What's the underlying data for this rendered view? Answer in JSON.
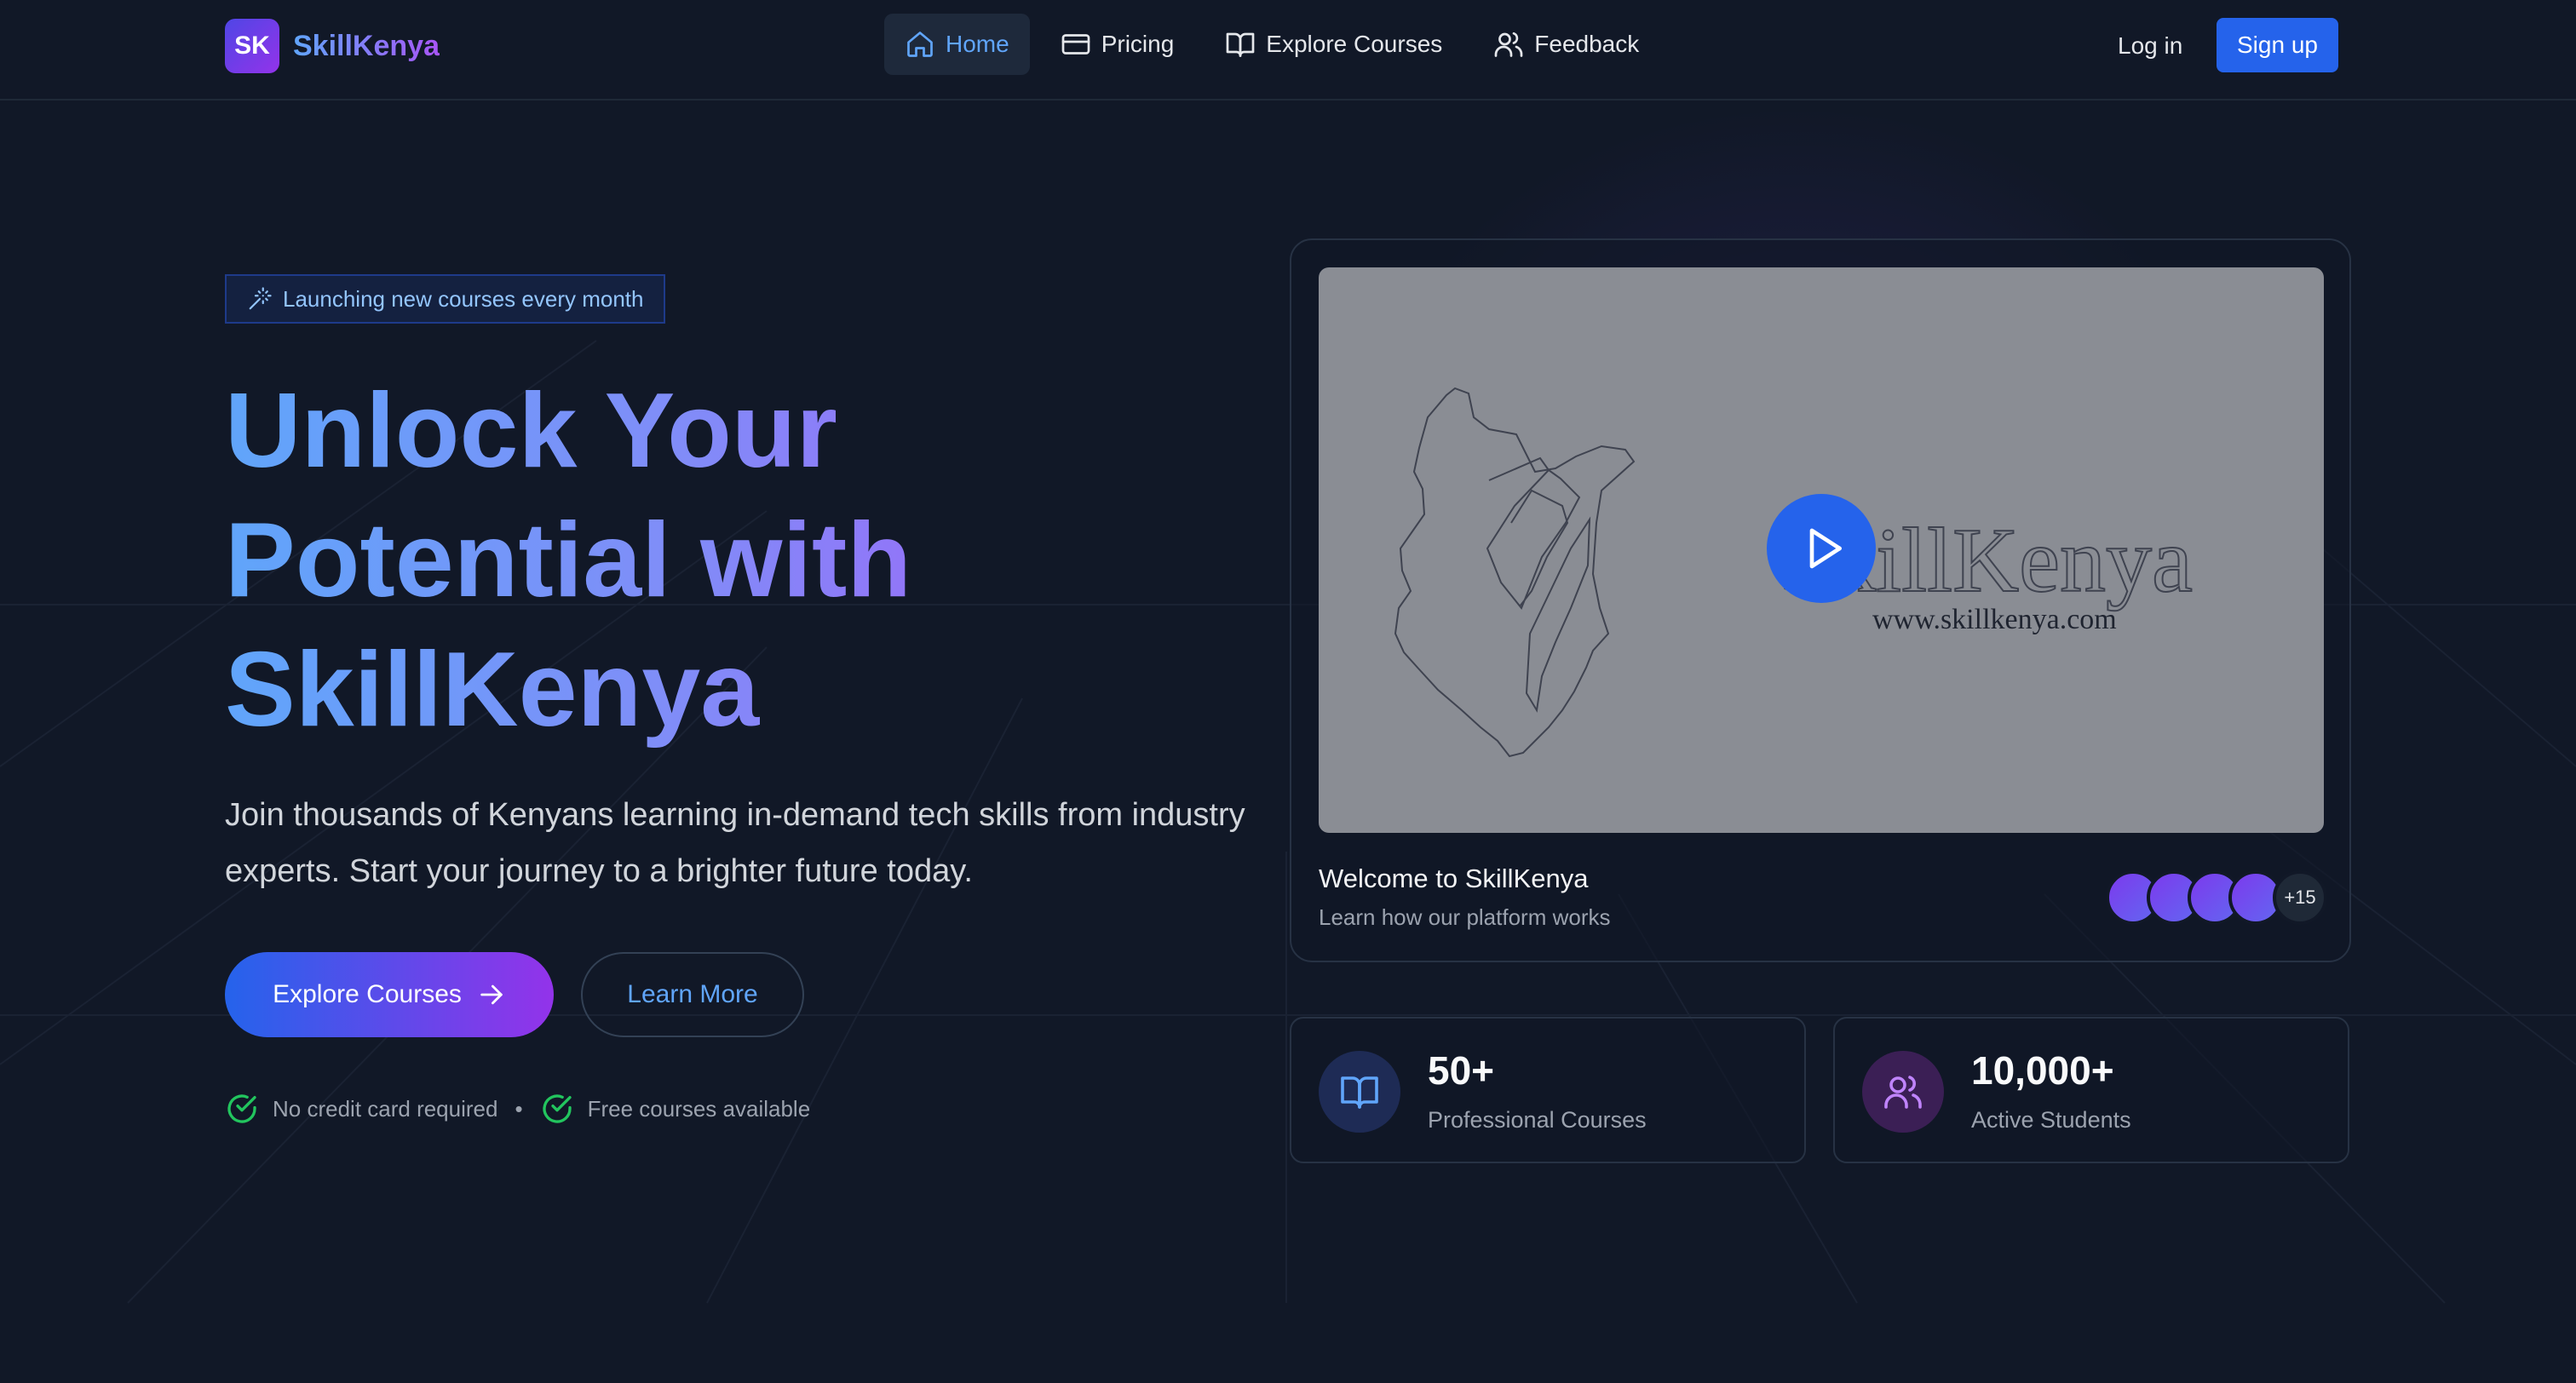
{
  "header": {
    "logo_mark": "SK",
    "logo_text": "SkillKenya",
    "nav": [
      {
        "label": "Home",
        "icon": "home-icon",
        "active": true
      },
      {
        "label": "Pricing",
        "icon": "credit-card-icon"
      },
      {
        "label": "Explore Courses",
        "icon": "book-open-icon"
      },
      {
        "label": "Feedback",
        "icon": "users-icon"
      }
    ],
    "login_label": "Log in",
    "signup_label": "Sign up"
  },
  "hero": {
    "badge": "Launching new courses every month",
    "badge_icon": "magic-wand-icon",
    "headline": [
      "Unlock Your",
      "Potential with",
      "SkillKenya"
    ],
    "subtext": "Join thousands of Kenyans learning in-demand tech skills from industry experts. Start your journey to a brighter future today.",
    "primary_button": "Explore Courses",
    "secondary_button": "Learn More",
    "perks": [
      "No credit card required",
      "Free courses available"
    ],
    "perk_separator": "•"
  },
  "video": {
    "title": "Welcome to SkillKenya",
    "subtitle": "Learn how our platform works",
    "thumbnail_brand": "SkillKenya",
    "thumbnail_url": "www.skillkenya.com",
    "avatars_more": "+15"
  },
  "stats": [
    {
      "value": "50+",
      "label": "Professional Courses",
      "icon": "book-open-icon"
    },
    {
      "value": "10,000+",
      "label": "Active Students",
      "icon": "users-icon"
    }
  ],
  "colors": {
    "background": "#111827",
    "primary": "#2563eb",
    "accent": "#9333ea",
    "link": "#60a5fa",
    "success": "#22c55e"
  }
}
